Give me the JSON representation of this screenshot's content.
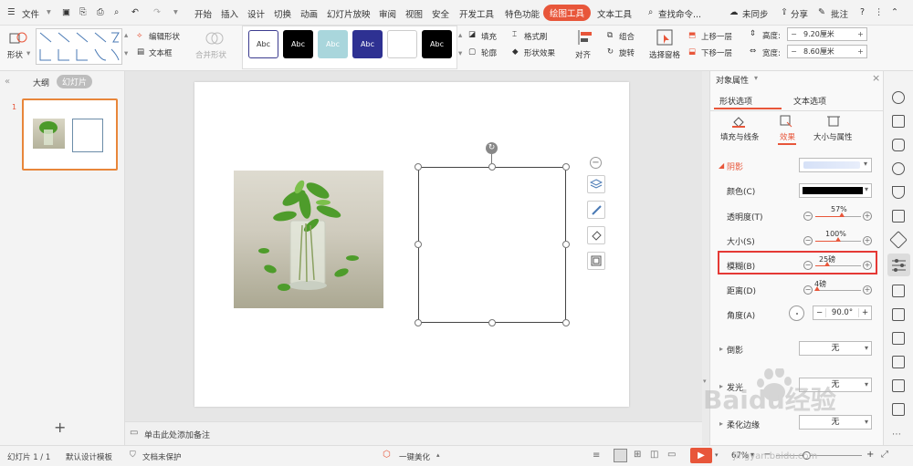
{
  "menubar": {
    "file": "文件",
    "items": [
      "开始",
      "插入",
      "设计",
      "切换",
      "动画",
      "幻灯片放映",
      "审阅",
      "视图",
      "安全",
      "开发工具",
      "特色功能"
    ],
    "active": "绘图工具",
    "text_tool": "文本工具",
    "search": "查找命令...",
    "sync": "未同步",
    "share": "分享",
    "comment": "批注",
    "help": "?"
  },
  "ribbon": {
    "shape": "形状",
    "edit_shape": "编辑形状",
    "textbox": "文本框",
    "merge_shape": "合并形状",
    "style_text": "Abc",
    "fill": "填充",
    "format_brush": "格式刷",
    "outline": "轮廓",
    "shape_effect": "形状效果",
    "align": "对齐",
    "group": "组合",
    "rotate": "旋转",
    "select_pane": "选择窗格",
    "bring_forward": "上移一层",
    "send_backward": "下移一层",
    "height_label": "高度:",
    "height_value": "9.20厘米",
    "width_label": "宽度:",
    "width_value": "8.60厘米",
    "minus": "−",
    "plus": "+"
  },
  "left_panel": {
    "tab_outline": "大纲",
    "tab_slides": "幻灯片",
    "slide_number": "1",
    "add": "+"
  },
  "notes": {
    "placeholder": "单击此处添加备注"
  },
  "props": {
    "title": "对象属性",
    "tab_shape": "形状选项",
    "tab_text": "文本选项",
    "sub_fill": "填充与线条",
    "sub_effect": "效果",
    "sub_size": "大小与属性",
    "shadow": "阴影",
    "color": "颜色(C)",
    "transparency": "透明度(T)",
    "transparency_value": "57%",
    "size": "大小(S)",
    "size_value": "100%",
    "blur": "模糊(B)",
    "blur_value": "25磅",
    "distance": "距离(D)",
    "distance_value": "4磅",
    "angle": "角度(A)",
    "angle_value": "90.0°",
    "reflection": "倒影",
    "reflection_value": "无",
    "glow": "发光",
    "glow_value": "无",
    "soft_edge": "柔化边缘",
    "soft_edge_value": "无",
    "transparency_level": 0.57,
    "size_level": 0.5,
    "blur_level": 0.25,
    "distance_level": 0.04
  },
  "statusbar": {
    "slide_info": "幻灯片 1 / 1",
    "template": "默认设计模板",
    "protect": "文档未保护",
    "beautify": "一键美化",
    "zoom": "67%",
    "minus": "−",
    "plus": "+"
  },
  "watermark": {
    "text": "Baidu经验",
    "url": "jingyan.baidu.com"
  },
  "colors": {
    "accent": "#e8563a",
    "highlight_box": "#e53935"
  }
}
